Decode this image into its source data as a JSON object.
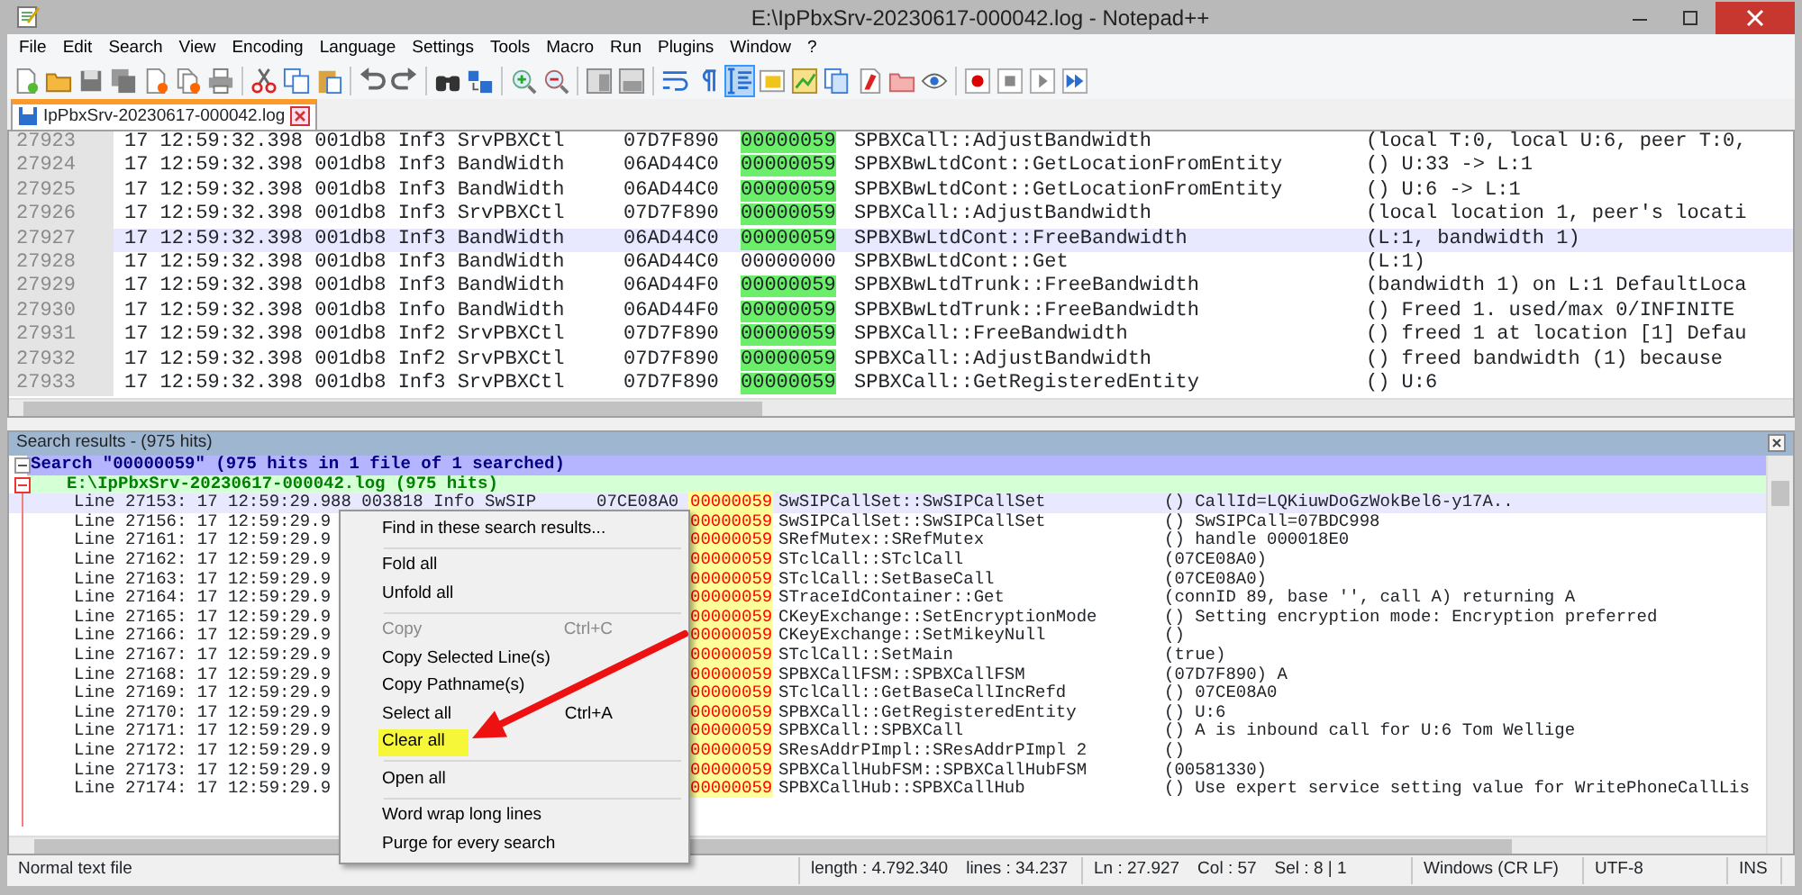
{
  "window": {
    "title": "E:\\IpPbxSrv-20230617-000042.log - Notepad++"
  },
  "menu": [
    "File",
    "Edit",
    "Search",
    "View",
    "Encoding",
    "Language",
    "Settings",
    "Tools",
    "Macro",
    "Run",
    "Plugins",
    "Window",
    "?"
  ],
  "toolbar": [
    {
      "pressed": false
    },
    {
      "pressed": false
    },
    {
      "pressed": false
    },
    {
      "pressed": false
    },
    {
      "pressed": false
    },
    {
      "pressed": false
    },
    {
      "pressed": false
    },
    {
      "pressed": false
    },
    {
      "pressed": false
    },
    {
      "pressed": false
    },
    {
      "pressed": false
    },
    {
      "pressed": false
    },
    {
      "pressed": false
    },
    {
      "pressed": false
    },
    {
      "pressed": false
    },
    {
      "pressed": false
    },
    {
      "pressed": false
    },
    {
      "pressed": false
    },
    {
      "pressed": false
    },
    {
      "pressed": false
    },
    {
      "pressed": true
    },
    {
      "pressed": false
    },
    {
      "pressed": false
    },
    {
      "pressed": false
    },
    {
      "pressed": false
    },
    {
      "pressed": false
    },
    {
      "pressed": false
    },
    {
      "pressed": false
    },
    {
      "pressed": false
    },
    {
      "pressed": false
    },
    {
      "pressed": false
    }
  ],
  "tabs": [
    {
      "label": "IpPbxSrv-20230617-000042.log",
      "selected": true
    }
  ],
  "editor": {
    "rows": [
      {
        "line": "27923",
        "text": "17 12:59:32.398 001db8 Inf3 SrvPBXCtl",
        "object": "07D7F890",
        "id": "00000059",
        "highlighted": true,
        "function": "SPBXCall::AdjustBandwidth",
        "message": "(local T:0, local U:6, peer T:0,",
        "selected": false
      },
      {
        "line": "27924",
        "text": "17 12:59:32.398 001db8 Inf3 BandWidth",
        "object": "06AD44C0",
        "id": "00000059",
        "highlighted": true,
        "function": "SPBXBwLtdCont::GetLocationFromEntity",
        "message": "() U:33 -> L:1",
        "selected": false
      },
      {
        "line": "27925",
        "text": "17 12:59:32.398 001db8 Inf3 BandWidth",
        "object": "06AD44C0",
        "id": "00000059",
        "highlighted": true,
        "function": "SPBXBwLtdCont::GetLocationFromEntity",
        "message": "() U:6 -> L:1",
        "selected": false
      },
      {
        "line": "27926",
        "text": "17 12:59:32.398 001db8 Inf3 SrvPBXCtl",
        "object": "07D7F890",
        "id": "00000059",
        "highlighted": true,
        "function": "SPBXCall::AdjustBandwidth",
        "message": "(local location 1, peer's locati",
        "selected": false
      },
      {
        "line": "27927",
        "text": "17 12:59:32.398 001db8 Inf3 BandWidth",
        "object": "06AD44C0",
        "id": "00000059",
        "highlighted": true,
        "function": "SPBXBwLtdCont::FreeBandwidth",
        "message": "(L:1, bandwidth 1)",
        "selected": true
      },
      {
        "line": "27928",
        "text": "17 12:59:32.398 001db8 Inf3 BandWidth",
        "object": "06AD44C0",
        "id": "00000000",
        "highlighted": false,
        "function": "SPBXBwLtdCont::Get",
        "message": "(L:1)",
        "selected": false
      },
      {
        "line": "27929",
        "text": "17 12:59:32.398 001db8 Inf3 BandWidth",
        "object": "06AD44F0",
        "id": "00000059",
        "highlighted": true,
        "function": "SPBXBwLtdTrunk::FreeBandwidth",
        "message": "(bandwidth 1) on L:1 DefaultLoca",
        "selected": false
      },
      {
        "line": "27930",
        "text": "17 12:59:32.398 001db8 Info BandWidth",
        "object": "06AD44F0",
        "id": "00000059",
        "highlighted": true,
        "function": "SPBXBwLtdTrunk::FreeBandwidth",
        "message": "() Freed 1. used/max 0/INFINITE",
        "selected": false
      },
      {
        "line": "27931",
        "text": "17 12:59:32.398 001db8 Inf2 SrvPBXCtl",
        "object": "07D7F890",
        "id": "00000059",
        "highlighted": true,
        "function": "SPBXCall::FreeBandwidth",
        "message": "() freed 1 at location [1] Defau",
        "selected": false
      },
      {
        "line": "27932",
        "text": "17 12:59:32.398 001db8 Inf2 SrvPBXCtl",
        "object": "07D7F890",
        "id": "00000059",
        "highlighted": true,
        "function": "SPBXCall::AdjustBandwidth",
        "message": "() freed bandwidth (1) because",
        "selected": false
      },
      {
        "line": "27933",
        "text": "17 12:59:32.398 001db8 Inf3 SrvPBXCtl",
        "object": "07D7F890",
        "id": "00000059",
        "highlighted": true,
        "function": "SPBXCall::GetRegisteredEntity",
        "message": "() U:6",
        "selected": false
      }
    ]
  },
  "search_results": {
    "title": "Search results - (975 hits)",
    "search": "Search \"00000059\" (975 hits in 1 file of 1 searched)",
    "file": "E:\\IpPbxSrv-20230617-000042.log (975 hits)",
    "rows": [
      {
        "prefix": "Line 27153: 17 12:59:29.988 003818 Info SwSIP",
        "object": "07CE08A0",
        "id": "00000059",
        "function": "SwSIPCallSet::SwSIPCallSet",
        "message": "() CallId=LQKiuwDoGzWokBel6-y17A..",
        "selected": true
      },
      {
        "prefix": "Line 27156: 17 12:59:29.9",
        "id": "00000059",
        "function": "SwSIPCallSet::SwSIPCallSet",
        "message": "() SwSIPCall=07BDC998",
        "selected": false
      },
      {
        "prefix": "Line 27161: 17 12:59:29.9",
        "id": "00000059",
        "function": "SRefMutex::SRefMutex",
        "message": "() handle 000018E0",
        "selected": false
      },
      {
        "prefix": "Line 27162: 17 12:59:29.9",
        "id": "00000059",
        "function": "STclCall::STclCall",
        "message": "(07CE08A0)",
        "selected": false
      },
      {
        "prefix": "Line 27163: 17 12:59:29.9",
        "id": "00000059",
        "function": "STclCall::SetBaseCall",
        "message": "(07CE08A0)",
        "selected": false
      },
      {
        "prefix": "Line 27164: 17 12:59:29.9",
        "id": "00000059",
        "function": "STraceIdContainer::Get",
        "message": "(connID 89, base '', call A) returning A",
        "selected": false
      },
      {
        "prefix": "Line 27165: 17 12:59:29.9",
        "id": "00000059",
        "function": "CKeyExchange::SetEncryptionMode",
        "message": "() Setting encryption mode: Encryption preferred",
        "selected": false
      },
      {
        "prefix": "Line 27166: 17 12:59:29.9",
        "id": "00000059",
        "function": "CKeyExchange::SetMikeyNull",
        "message": "()",
        "selected": false
      },
      {
        "prefix": "Line 27167: 17 12:59:29.9",
        "id": "00000059",
        "function": "STclCall::SetMain",
        "message": "(true)",
        "selected": false
      },
      {
        "prefix": "Line 27168: 17 12:59:29.9",
        "id": "00000059",
        "function": "SPBXCallFSM::SPBXCallFSM",
        "message": "(07D7F890) A",
        "selected": false
      },
      {
        "prefix": "Line 27169: 17 12:59:29.9",
        "id": "00000059",
        "function": "STclCall::GetBaseCallIncRefd",
        "message": "() 07CE08A0",
        "selected": false
      },
      {
        "prefix": "Line 27170: 17 12:59:29.9",
        "id": "00000059",
        "function": "SPBXCall::GetRegisteredEntity",
        "message": "() U:6",
        "selected": false
      },
      {
        "prefix": "Line 27171: 17 12:59:29.9",
        "id": "00000059",
        "function": "SPBXCall::SPBXCall",
        "message": "() A is inbound call for U:6 Tom Wellige",
        "selected": false
      },
      {
        "prefix": "Line 27172: 17 12:59:29.9",
        "id": "00000059",
        "function": "SResAddrPImpl::SResAddrPImpl 2",
        "message": "()",
        "selected": false
      },
      {
        "prefix": "Line 27173: 17 12:59:29.9",
        "id": "00000059",
        "function": "SPBXCallHubFSM::SPBXCallHubFSM",
        "message": "(00581330)",
        "selected": false
      },
      {
        "prefix": "Line 27174: 17 12:59:29.9",
        "id": "00000059",
        "function": "SPBXCallHub::SPBXCallHub",
        "message": "() Use expert service setting value for WritePhoneCallLis",
        "selected": false
      }
    ]
  },
  "context_menu": [
    {
      "kind": "item",
      "label": "Find in these search results...",
      "disabled": false,
      "highlighted": false
    },
    {
      "kind": "separator"
    },
    {
      "kind": "item",
      "label": "Fold all",
      "disabled": false,
      "highlighted": false
    },
    {
      "kind": "item",
      "label": "Unfold all",
      "disabled": false,
      "highlighted": false
    },
    {
      "kind": "separator"
    },
    {
      "kind": "item",
      "label": "Copy",
      "shortcut": "Ctrl+C",
      "disabled": true,
      "highlighted": false
    },
    {
      "kind": "item",
      "label": "Copy Selected Line(s)",
      "disabled": false,
      "highlighted": false
    },
    {
      "kind": "item",
      "label": "Copy Pathname(s)",
      "disabled": false,
      "highlighted": false
    },
    {
      "kind": "item",
      "label": "Select all",
      "shortcut": "Ctrl+A",
      "disabled": false,
      "highlighted": false
    },
    {
      "kind": "item",
      "label": "Clear all",
      "disabled": false,
      "highlighted": true
    },
    {
      "kind": "separator"
    },
    {
      "kind": "item",
      "label": "Open all",
      "disabled": false,
      "highlighted": false
    },
    {
      "kind": "separator"
    },
    {
      "kind": "item",
      "label": "Word wrap long lines",
      "disabled": false,
      "highlighted": false
    },
    {
      "kind": "item",
      "label": "Purge for every search",
      "disabled": false,
      "highlighted": false
    }
  ],
  "status_bar": [
    [
      "Normal text file"
    ],
    [
      "length : 4.792.340",
      "lines : 34.237"
    ],
    [
      "Ln : 27.927",
      "Col : 57",
      "Sel : 8 | 1"
    ],
    [
      "Windows (CR LF)"
    ],
    [
      "UTF-8"
    ],
    [
      "INS"
    ]
  ]
}
